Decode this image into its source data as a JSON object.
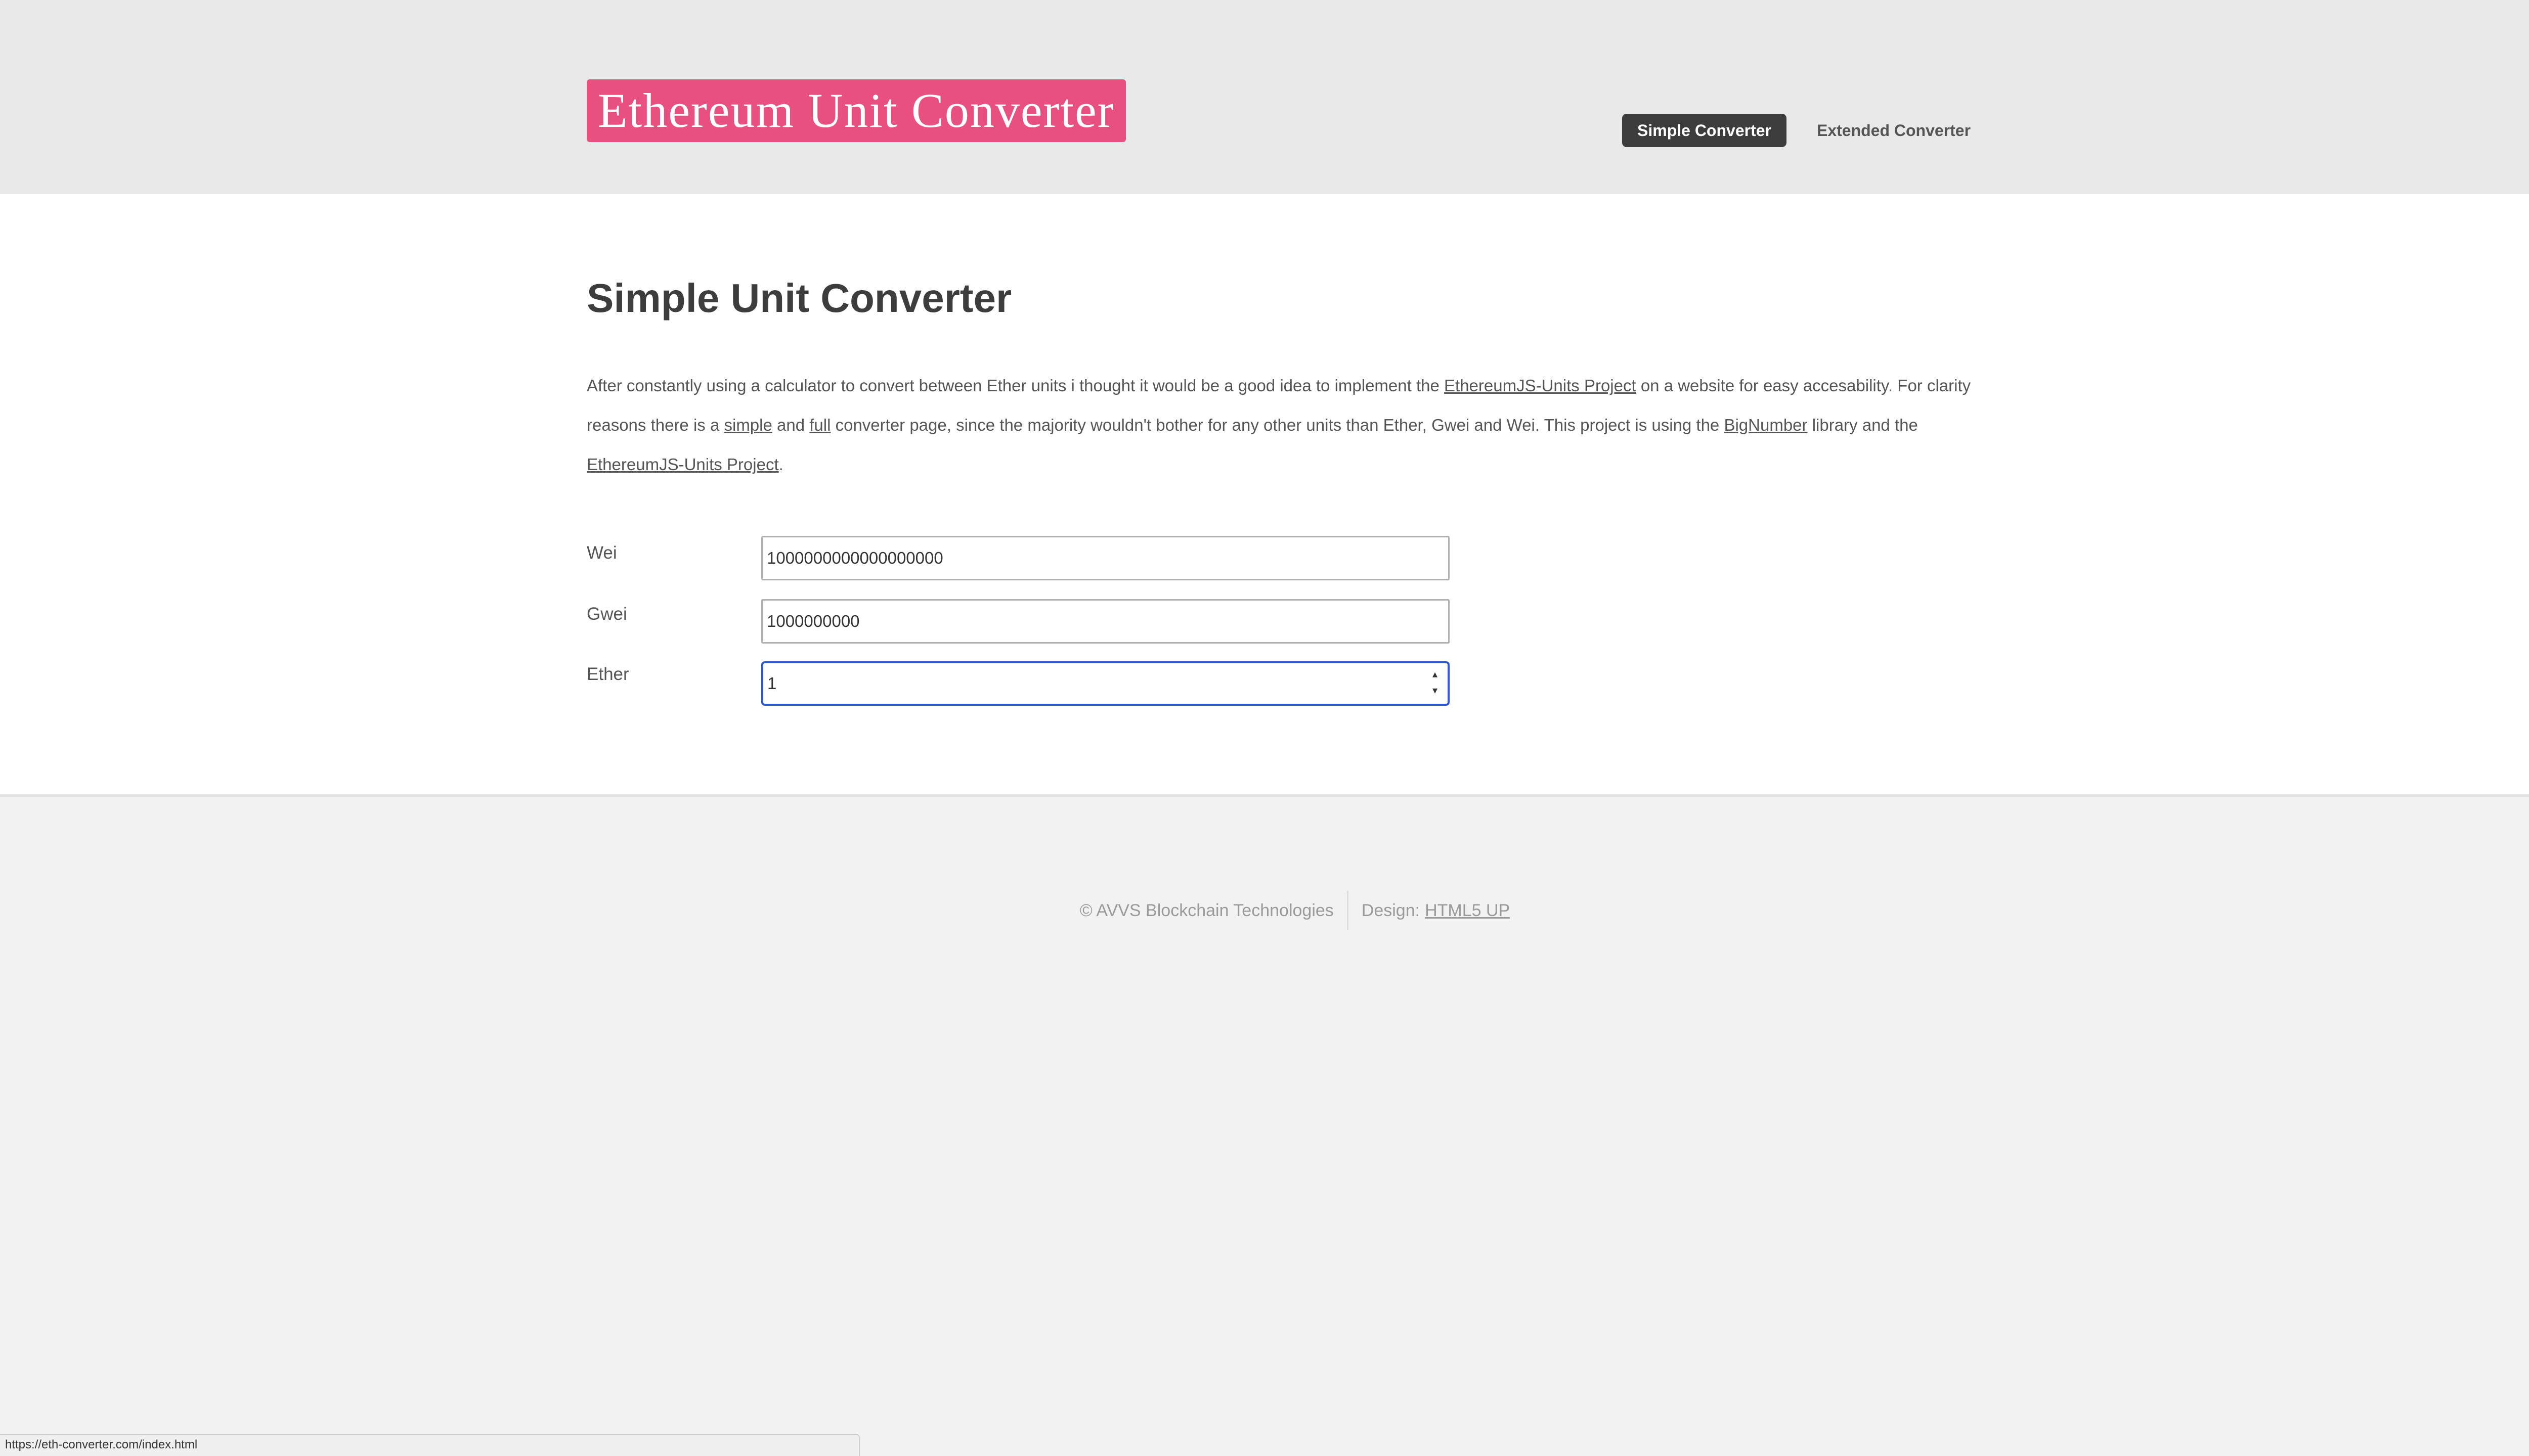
{
  "header": {
    "logo_text": "Ethereum Unit Converter",
    "nav": [
      {
        "label": "Simple Converter",
        "active": true
      },
      {
        "label": "Extended Converter",
        "active": false
      }
    ],
    "logo_color": "#e8507f",
    "active_nav_color": "#3c3c3c"
  },
  "main": {
    "title": "Simple Unit Converter",
    "intro": {
      "part1": "After constantly using a calculator to convert between Ether units i thought it would be a good idea to implement the ",
      "link1": "EthereumJS-Units Project",
      "part2": " on a website for easy accesability. For clarity reasons there is a ",
      "link_simple": "simple",
      "part3": " and ",
      "link_full": "full",
      "part4": " converter page, since the majority wouldn't bother for any other units than Ether, Gwei and Wei. This project is using the ",
      "link_bignumber": "BigNumber",
      "part5": " library and the ",
      "link2": "EthereumJS-Units Project",
      "part6": "."
    },
    "fields": [
      {
        "label": "Wei",
        "value": "1000000000000000000"
      },
      {
        "label": "Gwei",
        "value": "1000000000"
      },
      {
        "label": "Ether",
        "value": "1"
      }
    ]
  },
  "footer": {
    "copyright": "© AVVS Blockchain Technologies",
    "design_label": "Design:",
    "design_link": "HTML5 UP"
  },
  "status_bar": {
    "url": "https://eth-converter.com/index.html"
  }
}
